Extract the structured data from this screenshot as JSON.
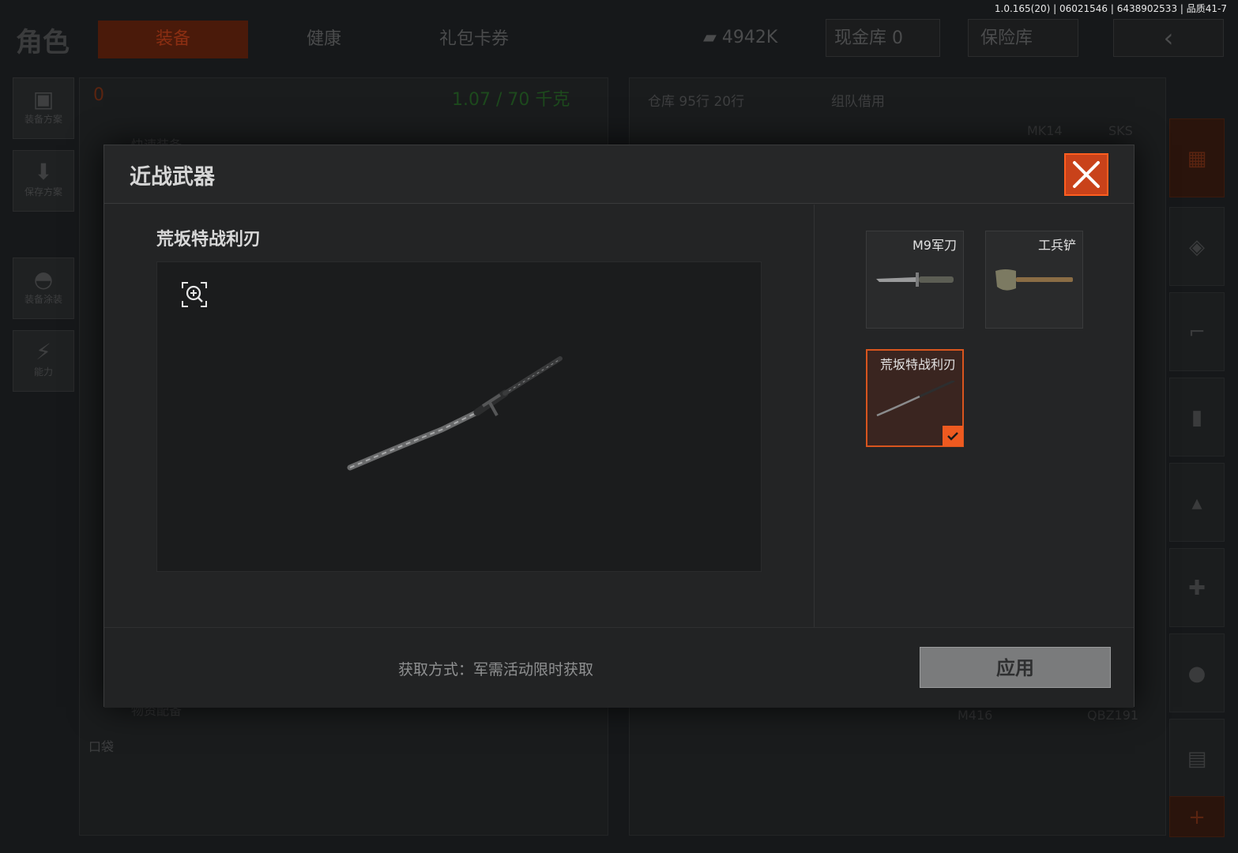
{
  "version_line": "1.0.165(20) | 06021546 | 6438902533 | 品质41-7",
  "background": {
    "role_title": "角色",
    "tabs": [
      "装备",
      "健康",
      "礼包卡券"
    ],
    "money": "4942K",
    "cash_vault": "现金库 0",
    "safe_vault": "保险库",
    "left_nav": [
      "装备方案",
      "保存方案",
      "装备涂装",
      "能力"
    ],
    "zero_count": "0",
    "weight": "1.07 / 70 千克",
    "warehouse": "仓库  95行  20行",
    "team_borrow": "组队借用",
    "quick_equip": "快速装备",
    "weapon_labels": [
      "MK14",
      "SKS",
      "M416",
      "QBZ191"
    ],
    "pocket": "口袋",
    "supplies": "物资配备"
  },
  "modal": {
    "title": "近战武器",
    "close_icon": "close-icon",
    "preview": {
      "item_name": "荒坂特战利刃",
      "zoom_icon": "zoom-in-icon"
    },
    "items": [
      {
        "name": "M9军刀",
        "icon": "bayonet-icon",
        "selected": false
      },
      {
        "name": "工兵铲",
        "icon": "shovel-icon",
        "selected": false
      },
      {
        "name": "荒坂特战利刃",
        "icon": "katana-icon",
        "selected": true
      }
    ],
    "acquire_text": "获取方式：军需活动限时获取",
    "apply_label": "应用"
  },
  "colors": {
    "accent_orange": "#ee5a20",
    "modal_bg": "#242526",
    "apply_bg": "#7a7b7c"
  }
}
